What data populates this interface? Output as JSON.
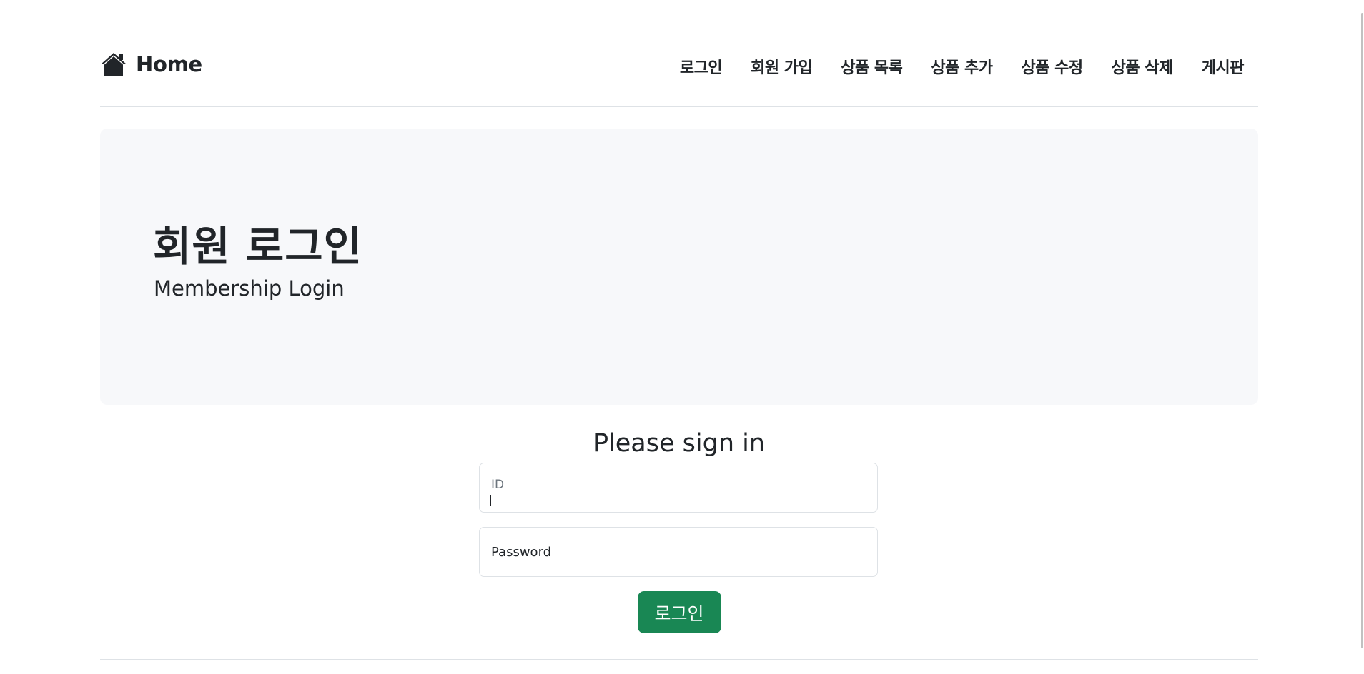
{
  "header": {
    "brand_label": "Home",
    "brand_icon": "house-icon",
    "nav": [
      {
        "label": "로그인"
      },
      {
        "label": "회원 가입"
      },
      {
        "label": "상품 목록"
      },
      {
        "label": "상품 추가"
      },
      {
        "label": "상품 수정"
      },
      {
        "label": "상품 삭제"
      },
      {
        "label": "게시판"
      }
    ]
  },
  "hero": {
    "title": "회원 로그인",
    "subtitle": "Membership Login"
  },
  "signin": {
    "heading": "Please sign in",
    "id_field": {
      "label": "ID",
      "value": ""
    },
    "password_field": {
      "label": "Password",
      "value": ""
    },
    "submit_label": "로그인",
    "submit_color": "#198754"
  }
}
